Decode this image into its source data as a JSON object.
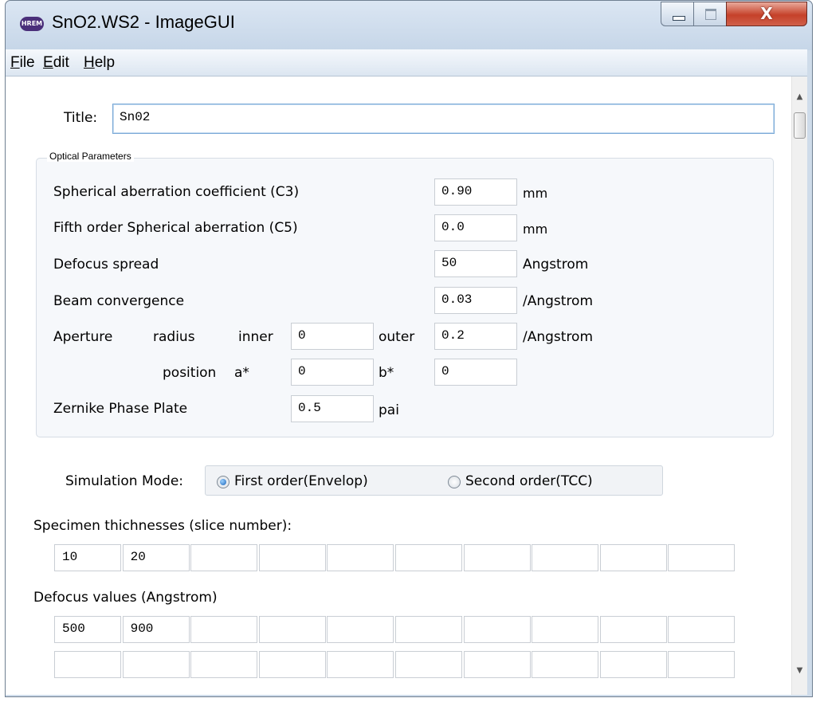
{
  "window": {
    "app_icon_text": "HREM",
    "title": "SnO2.WS2 - ImageGUI",
    "close_glyph": "X"
  },
  "menu": {
    "file": {
      "mnemonic": "F",
      "rest": "ile"
    },
    "edit": {
      "mnemonic": "E",
      "rest": "dit"
    },
    "help": {
      "mnemonic": "H",
      "rest": "elp"
    }
  },
  "form": {
    "title_label": "Title:",
    "title_value": "Sn02"
  },
  "optical": {
    "legend": "Optical Parameters",
    "c3": {
      "label": "Spherical aberration coefficient (C3)",
      "value": "0.90",
      "unit": "mm"
    },
    "c5": {
      "label": "Fifth order Spherical aberration (C5)",
      "value": "0.0",
      "unit": "mm"
    },
    "defocus_spread": {
      "label": "Defocus spread",
      "value": "50",
      "unit": "Angstrom"
    },
    "beam_convergence": {
      "label": "Beam convergence",
      "value": "0.03",
      "unit": "/Angstrom"
    },
    "aperture": {
      "label": "Aperture",
      "radius_label": "radius",
      "inner_label": "inner",
      "inner_value": "0",
      "outer_label": "outer",
      "outer_value": "0.2",
      "unit": "/Angstrom",
      "position_label": "position",
      "a_label": "a*",
      "a_value": "0",
      "b_label": "b*",
      "b_value": "0"
    },
    "zernike": {
      "label": "Zernike Phase Plate",
      "value": "0.5",
      "unit": "pai"
    }
  },
  "simulation": {
    "label": "Simulation Mode:",
    "options": [
      {
        "label": "First order(Envelop)",
        "selected": true
      },
      {
        "label": "Second order(TCC)",
        "selected": false
      }
    ]
  },
  "thickness": {
    "label": "Specimen thichnesses (slice number):",
    "values": [
      "10",
      "20",
      "",
      "",
      "",
      "",
      "",
      "",
      "",
      ""
    ]
  },
  "defocus": {
    "label": "Defocus values (Angstrom)",
    "row1": [
      "500",
      "900",
      "",
      "",
      "",
      "",
      "",
      "",
      "",
      ""
    ],
    "row2": [
      "",
      "",
      "",
      "",
      "",
      "",
      "",
      "",
      "",
      ""
    ]
  },
  "scrollbar": {
    "up_glyph": "▲",
    "down_glyph": "▼"
  }
}
